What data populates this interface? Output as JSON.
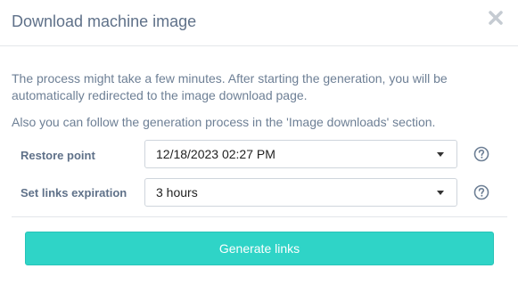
{
  "dialog": {
    "title": "Download machine image",
    "close_icon": "close-icon"
  },
  "description": {
    "line1": "The process might take a few minutes. After starting the generation, you will be automatically redirected to the image download page.",
    "line2": "Also you can follow the generation process in the 'Image downloads' section."
  },
  "form": {
    "restore_point": {
      "label": "Restore point",
      "value": "12/18/2023 02:27 PM",
      "help_icon": "question-circle-icon"
    },
    "links_expiration": {
      "label": "Set links expiration",
      "value": "3 hours",
      "help_icon": "question-circle-icon"
    }
  },
  "actions": {
    "generate_label": "Generate links"
  },
  "colors": {
    "accent": "#2fd4c7",
    "title_text": "#5f7189",
    "body_text": "#6d7f95"
  }
}
